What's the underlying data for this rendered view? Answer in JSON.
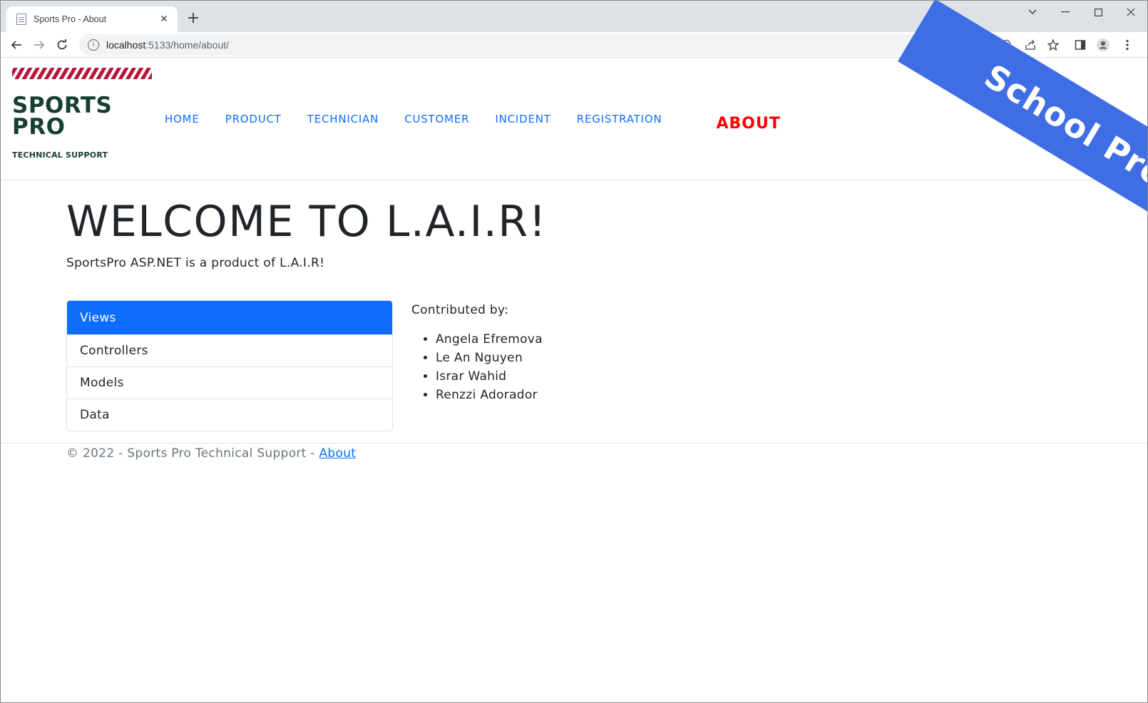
{
  "browser": {
    "tab_title": "Sports Pro - About",
    "url_host": "localhost",
    "url_path": ":5133/home/about/"
  },
  "ribbon": {
    "text": "School Project"
  },
  "logo": {
    "line1": "SPORTS",
    "line2": "PRO",
    "subtitle": "TECHNICAL SUPPORT"
  },
  "nav": {
    "items": [
      {
        "label": "HOME"
      },
      {
        "label": "PRODUCT"
      },
      {
        "label": "TECHNICIAN"
      },
      {
        "label": "CUSTOMER"
      },
      {
        "label": "INCIDENT"
      },
      {
        "label": "REGISTRATION"
      },
      {
        "label": "ABOUT"
      }
    ],
    "active": "ABOUT"
  },
  "main": {
    "title": "WELCOME TO L.A.I.R!",
    "lead": "SportsPro ASP.NET is a product of L.A.I.R!",
    "sections": [
      {
        "label": "Views"
      },
      {
        "label": "Controllers"
      },
      {
        "label": "Models"
      },
      {
        "label": "Data"
      }
    ],
    "active_section": "Views",
    "contributors_title": "Contributed by:",
    "contributors": [
      "Angela Efremova",
      "Le An Nguyen",
      "Israr Wahid",
      "Renzzi Adorador"
    ]
  },
  "footer": {
    "text": "© 2022 - Sports Pro Technical Support - ",
    "link_label": "About"
  },
  "colors": {
    "primary": "#0d6efd",
    "active_nav": "#ff0000",
    "logo_green": "#173e33",
    "logo_stripe": "#b5163a",
    "ribbon": "#3e6de4"
  }
}
